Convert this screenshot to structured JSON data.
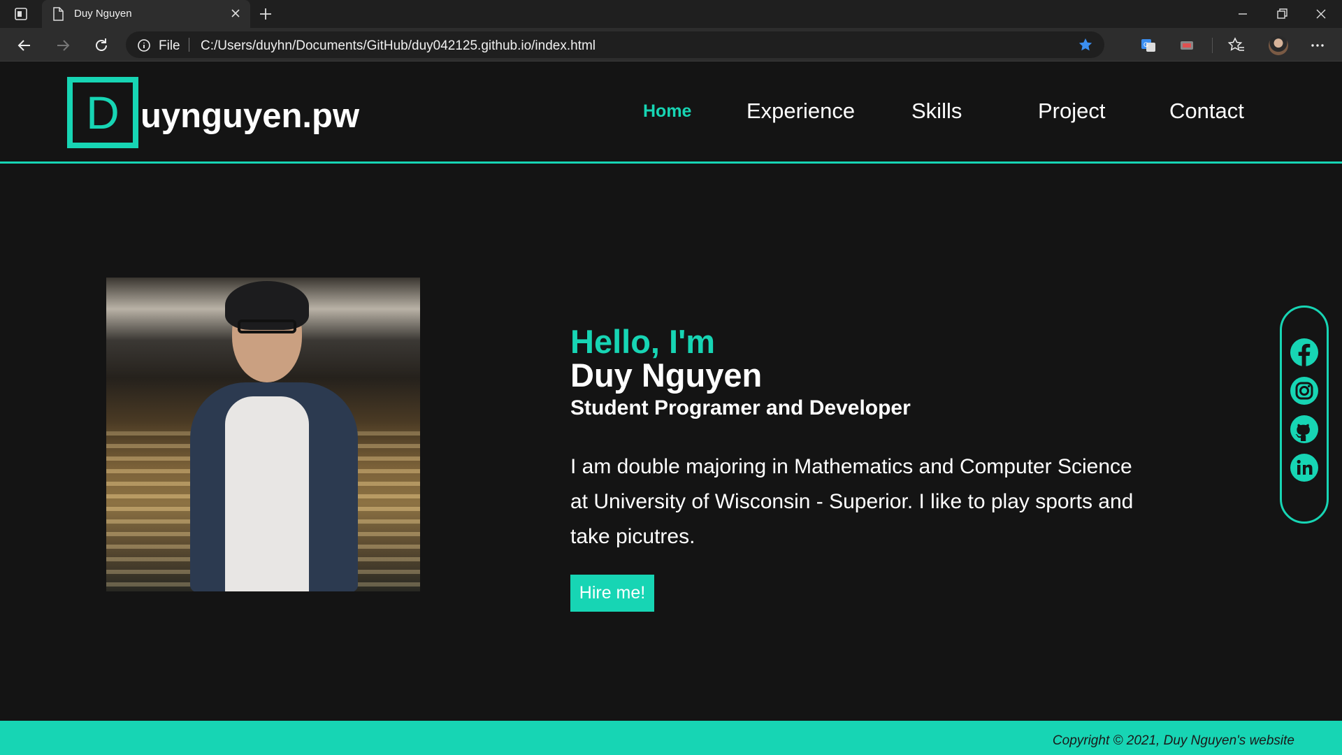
{
  "browser": {
    "tab_title": "Duy Nguyen",
    "scheme_label": "File",
    "url": "C:/Users/duyhn/Documents/GitHub/duy042125.github.io/index.html"
  },
  "header": {
    "logo_letter": "D",
    "logo_text": "uynguyen.pw",
    "nav": [
      {
        "label": "Home",
        "active": true
      },
      {
        "label": "Experience"
      },
      {
        "label": "Skills"
      },
      {
        "label": "Project"
      },
      {
        "label": "Contact"
      }
    ]
  },
  "hero": {
    "greeting": "Hello, I'm",
    "name": "Duy Nguyen",
    "role": "Student Programer and Developer",
    "bio": "I am double majoring in Mathematics and Computer Science at University of Wisconsin - Superior. I like to play sports and take picutres.",
    "hire_label": "Hire me!"
  },
  "social": [
    "facebook-icon",
    "instagram-icon",
    "github-icon",
    "linkedin-icon"
  ],
  "footer": {
    "copyright": "Copyright © 2021, Duy Nguyen's website"
  },
  "colors": {
    "accent": "#17d5b4",
    "background": "#141414",
    "chrome": "#2d2d2d"
  }
}
